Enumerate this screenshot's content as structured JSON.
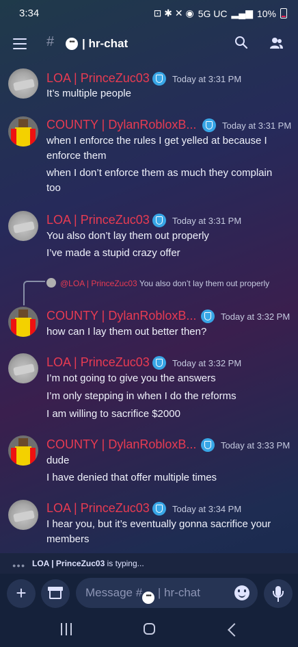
{
  "status_bar": {
    "time": "3:34",
    "network": "5G UC",
    "battery": "10%"
  },
  "header": {
    "channel_name": "hr-chat",
    "icons": [
      "menu-icon",
      "hash-icon",
      "speech-bubble-icon",
      "search-icon",
      "members-icon"
    ]
  },
  "messages": [
    {
      "author": "LOA | PrinceZuc03",
      "time": "Today at 3:31 PM",
      "lines": [
        "It’s multiple people"
      ]
    },
    {
      "author": "COUNTY | DylanRobloxB...",
      "time": "Today at 3:31 PM",
      "lines": [
        "when I enforce the rules I get yelled at because I enforce them",
        "when I don’t enforce them as much they complain too"
      ]
    },
    {
      "author": "LOA | PrinceZuc03",
      "time": "Today at 3:31 PM",
      "lines": [
        "You also don’t lay them out properly",
        "I’ve made a stupid crazy offer"
      ]
    },
    {
      "reply_mention": "@LOA | PrinceZuc03",
      "reply_text": "You also don’t lay them out properly",
      "author": "COUNTY | DylanRobloxB...",
      "time": "Today at 3:32 PM",
      "lines": [
        "how can I lay them out better then?"
      ]
    },
    {
      "author": "LOA | PrinceZuc03",
      "time": "Today at 3:32 PM",
      "lines": [
        "I’m not going to give you the answers",
        "I’m only stepping in when I do the reforms",
        "I am willing to sacrifice $2000"
      ]
    },
    {
      "author": "COUNTY | DylanRobloxB...",
      "time": "Today at 3:33 PM",
      "lines": [
        "dude",
        "I have denied that offer multiple times"
      ]
    },
    {
      "author": "LOA | PrinceZuc03",
      "time": "Today at 3:34 PM",
      "lines": [
        "I hear you, but it’s eventually gonna sacrifice your members"
      ]
    }
  ],
  "typing": {
    "user": "LOA | PrinceZuc03",
    "suffix": "is typing..."
  },
  "composer": {
    "placeholder_prefix": "Message #",
    "placeholder_channel": "hr-chat"
  },
  "colors": {
    "author_role": "#e83b52",
    "badge": "#38a6e6",
    "timestamp": "#c6cbe0"
  }
}
